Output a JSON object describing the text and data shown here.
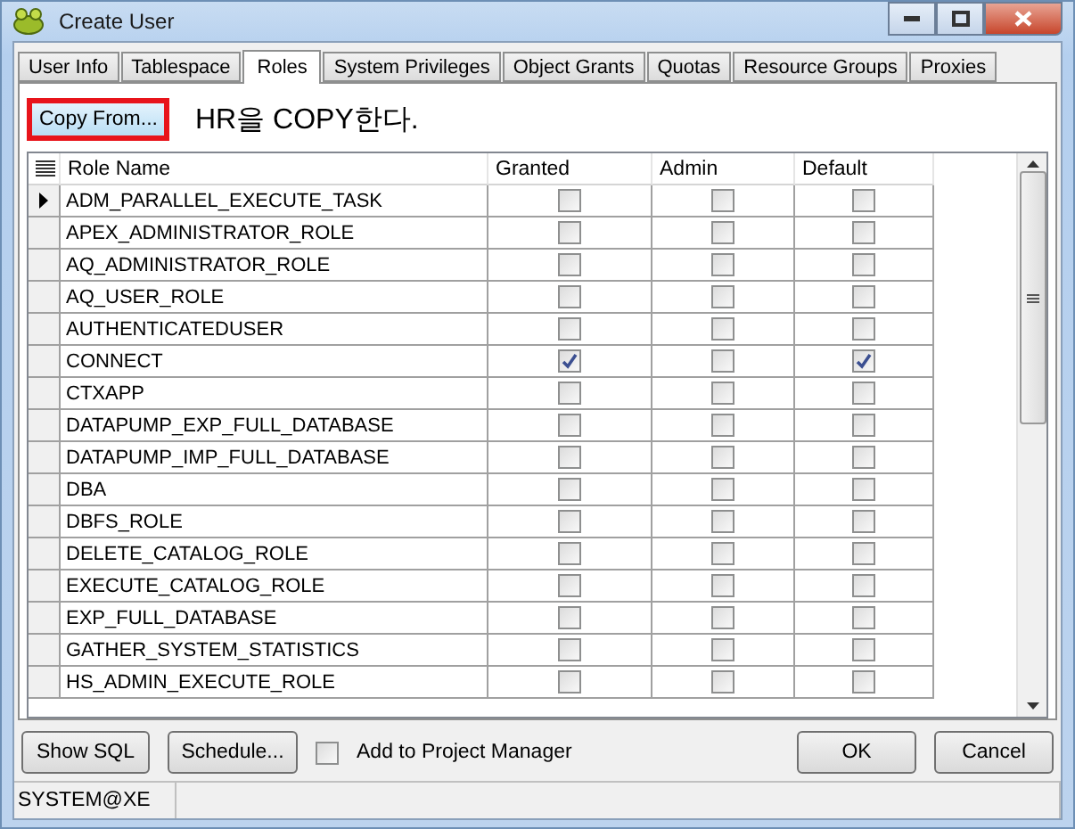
{
  "window": {
    "title": "Create User"
  },
  "tabs": [
    {
      "label": "User Info",
      "selected": false
    },
    {
      "label": "Tablespace",
      "selected": false
    },
    {
      "label": "Roles",
      "selected": true
    },
    {
      "label": "System Privileges",
      "selected": false
    },
    {
      "label": "Object Grants",
      "selected": false
    },
    {
      "label": "Quotas",
      "selected": false
    },
    {
      "label": "Resource Groups",
      "selected": false
    },
    {
      "label": "Proxies",
      "selected": false
    }
  ],
  "copy_button": {
    "label": "Copy From...",
    "highlighted": true
  },
  "annotation": "HR을 COPY한다.",
  "table": {
    "columns": [
      "Role Name",
      "Granted",
      "Admin",
      "Default"
    ],
    "rows": [
      {
        "name": "ADM_PARALLEL_EXECUTE_TASK",
        "current": true,
        "granted": false,
        "admin": false,
        "default": false
      },
      {
        "name": "APEX_ADMINISTRATOR_ROLE",
        "current": false,
        "granted": false,
        "admin": false,
        "default": false
      },
      {
        "name": "AQ_ADMINISTRATOR_ROLE",
        "current": false,
        "granted": false,
        "admin": false,
        "default": false
      },
      {
        "name": "AQ_USER_ROLE",
        "current": false,
        "granted": false,
        "admin": false,
        "default": false
      },
      {
        "name": "AUTHENTICATEDUSER",
        "current": false,
        "granted": false,
        "admin": false,
        "default": false
      },
      {
        "name": "CONNECT",
        "current": false,
        "granted": true,
        "admin": false,
        "default": true
      },
      {
        "name": "CTXAPP",
        "current": false,
        "granted": false,
        "admin": false,
        "default": false
      },
      {
        "name": "DATAPUMP_EXP_FULL_DATABASE",
        "current": false,
        "granted": false,
        "admin": false,
        "default": false
      },
      {
        "name": "DATAPUMP_IMP_FULL_DATABASE",
        "current": false,
        "granted": false,
        "admin": false,
        "default": false
      },
      {
        "name": "DBA",
        "current": false,
        "granted": false,
        "admin": false,
        "default": false
      },
      {
        "name": "DBFS_ROLE",
        "current": false,
        "granted": false,
        "admin": false,
        "default": false
      },
      {
        "name": "DELETE_CATALOG_ROLE",
        "current": false,
        "granted": false,
        "admin": false,
        "default": false
      },
      {
        "name": "EXECUTE_CATALOG_ROLE",
        "current": false,
        "granted": false,
        "admin": false,
        "default": false
      },
      {
        "name": "EXP_FULL_DATABASE",
        "current": false,
        "granted": false,
        "admin": false,
        "default": false
      },
      {
        "name": "GATHER_SYSTEM_STATISTICS",
        "current": false,
        "granted": false,
        "admin": false,
        "default": false
      },
      {
        "name": "HS_ADMIN_EXECUTE_ROLE",
        "current": false,
        "granted": false,
        "admin": false,
        "default": false
      }
    ]
  },
  "buttons": {
    "show_sql": "Show SQL",
    "schedule": "Schedule...",
    "ok": "OK",
    "cancel": "Cancel"
  },
  "add_to_project": {
    "label": "Add to Project Manager",
    "checked": false
  },
  "status_bar": {
    "connection": "SYSTEM@XE"
  }
}
